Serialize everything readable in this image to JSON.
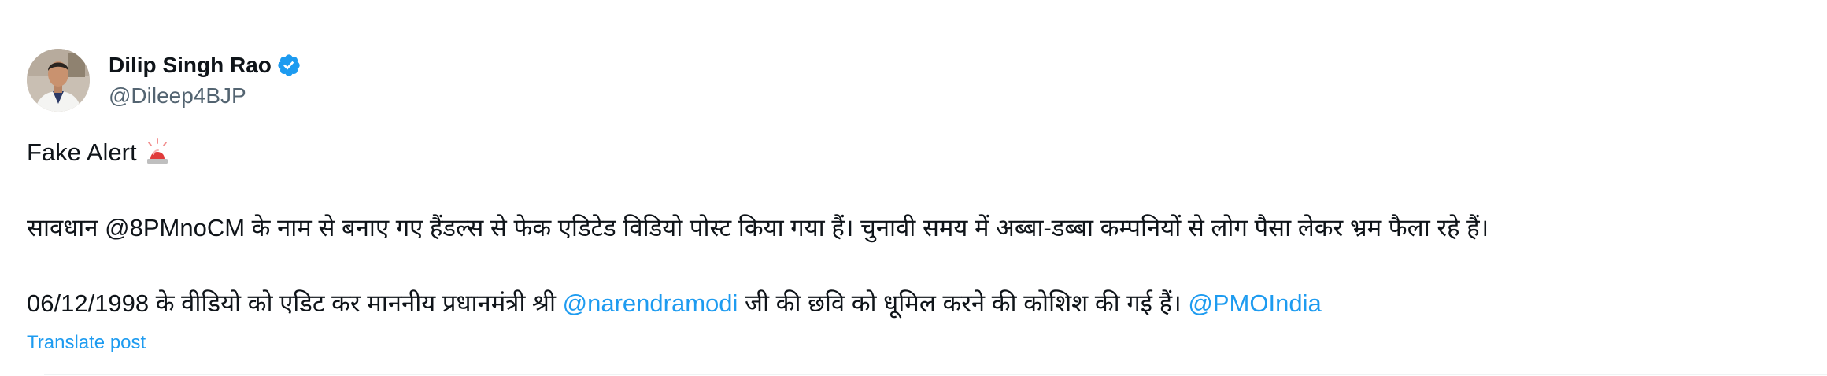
{
  "author": {
    "display_name": "Dilip Singh Rao",
    "handle": "@Dileep4BJP",
    "verified_icon": "verified-badge-icon",
    "avatar_icon": "profile-photo"
  },
  "post": {
    "line1": "Fake Alert",
    "line1_emoji": "police-car-light-icon",
    "line2": "सावधान @8PMnoCM के नाम से बनाए गए हैंडल्स से फेक एडिटेड विडियो पोस्ट किया गया हैं। चुनावी समय में अब्बा-डब्बा कम्पनियों से लोग पैसा लेकर भ्रम फैला रहे हैं।",
    "line3_part1": "06/12/1998 के वीडियो को एडिट कर माननीय प्रधानमंत्री श्री ",
    "line3_mention1": "@narendramodi",
    "line3_part2": " जी की छवि को धूमिल करने की कोशिश की गई हैं। ",
    "line3_mention2": "@PMOIndia"
  },
  "actions": {
    "translate_label": "Translate post"
  },
  "colors": {
    "link": "#1d9bf0",
    "secondary_text": "#536471",
    "primary_text": "#0f1419",
    "verified": "#1d9bf0"
  }
}
